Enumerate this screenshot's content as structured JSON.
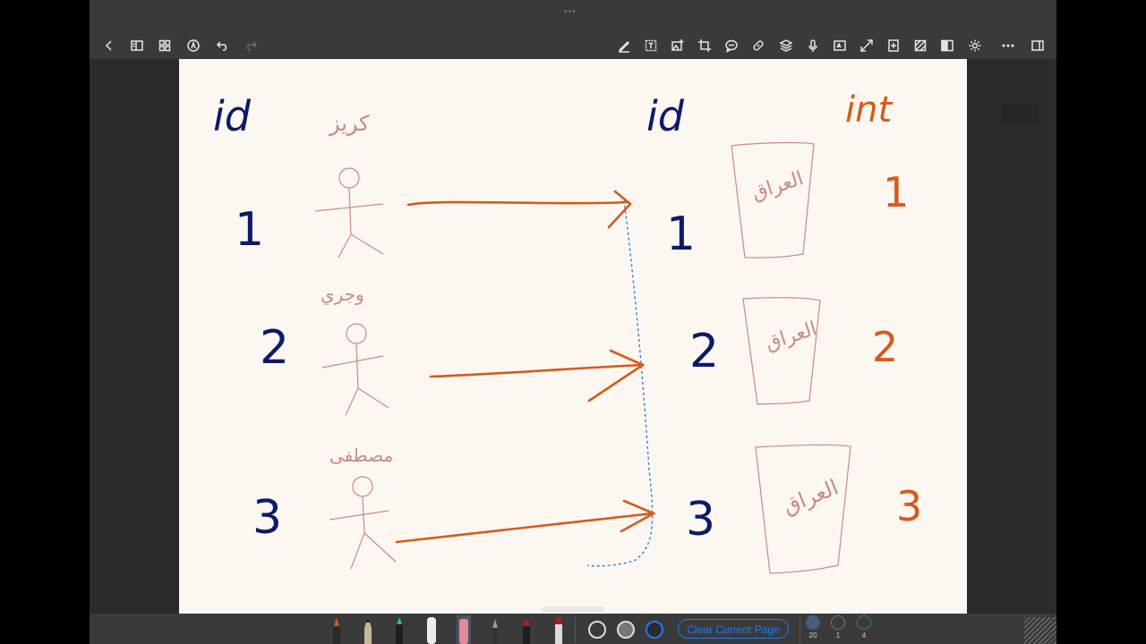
{
  "toolbar": {
    "left": [
      {
        "name": "back-icon",
        "label": "Back"
      },
      {
        "name": "sidebar-panel-icon",
        "label": "Panels"
      },
      {
        "name": "grid-pages-icon",
        "label": "Pages"
      },
      {
        "name": "pen-mode-icon",
        "label": "Pen mode"
      },
      {
        "name": "undo-icon",
        "label": "Undo"
      },
      {
        "name": "redo-icon",
        "label": "Redo"
      }
    ],
    "right": [
      {
        "name": "pen-tool-icon"
      },
      {
        "name": "text-tool-icon"
      },
      {
        "name": "image-add-icon"
      },
      {
        "name": "crop-icon"
      },
      {
        "name": "comment-icon"
      },
      {
        "name": "link-icon"
      },
      {
        "name": "layers-icon"
      },
      {
        "name": "microphone-icon"
      },
      {
        "name": "scan-text-icon"
      },
      {
        "name": "expand-icon"
      },
      {
        "name": "add-page-icon"
      },
      {
        "name": "template-icon"
      },
      {
        "name": "split-view-icon"
      },
      {
        "name": "settings-icon"
      },
      {
        "name": "more-icon"
      },
      {
        "name": "sidebar-toggle-icon"
      }
    ]
  },
  "canvas": {
    "left_header": "id",
    "left_names": [
      "كريز",
      "وجري",
      "مصطفى"
    ],
    "left_ids": [
      "1",
      "2",
      "3"
    ],
    "right_header_id": "id",
    "right_header_int": "int",
    "right_ids": [
      "1",
      "2",
      "3"
    ],
    "box_labels": [
      "العراق",
      "العراق",
      "العراق"
    ],
    "int_values": [
      "1",
      "2",
      "3"
    ],
    "colors": {
      "ink_blue": "#0b1a6b",
      "ink_orange": "#d65a1c",
      "ink_pink": "#c98a86",
      "dashed_blue": "#2f7fd6"
    }
  },
  "bottombar": {
    "clear_label": "Clear Current Page",
    "presets": [
      {
        "label": "20"
      },
      {
        "label": "1"
      },
      {
        "label": "4"
      }
    ],
    "colors": {
      "accent": "#1e7bf5"
    }
  }
}
